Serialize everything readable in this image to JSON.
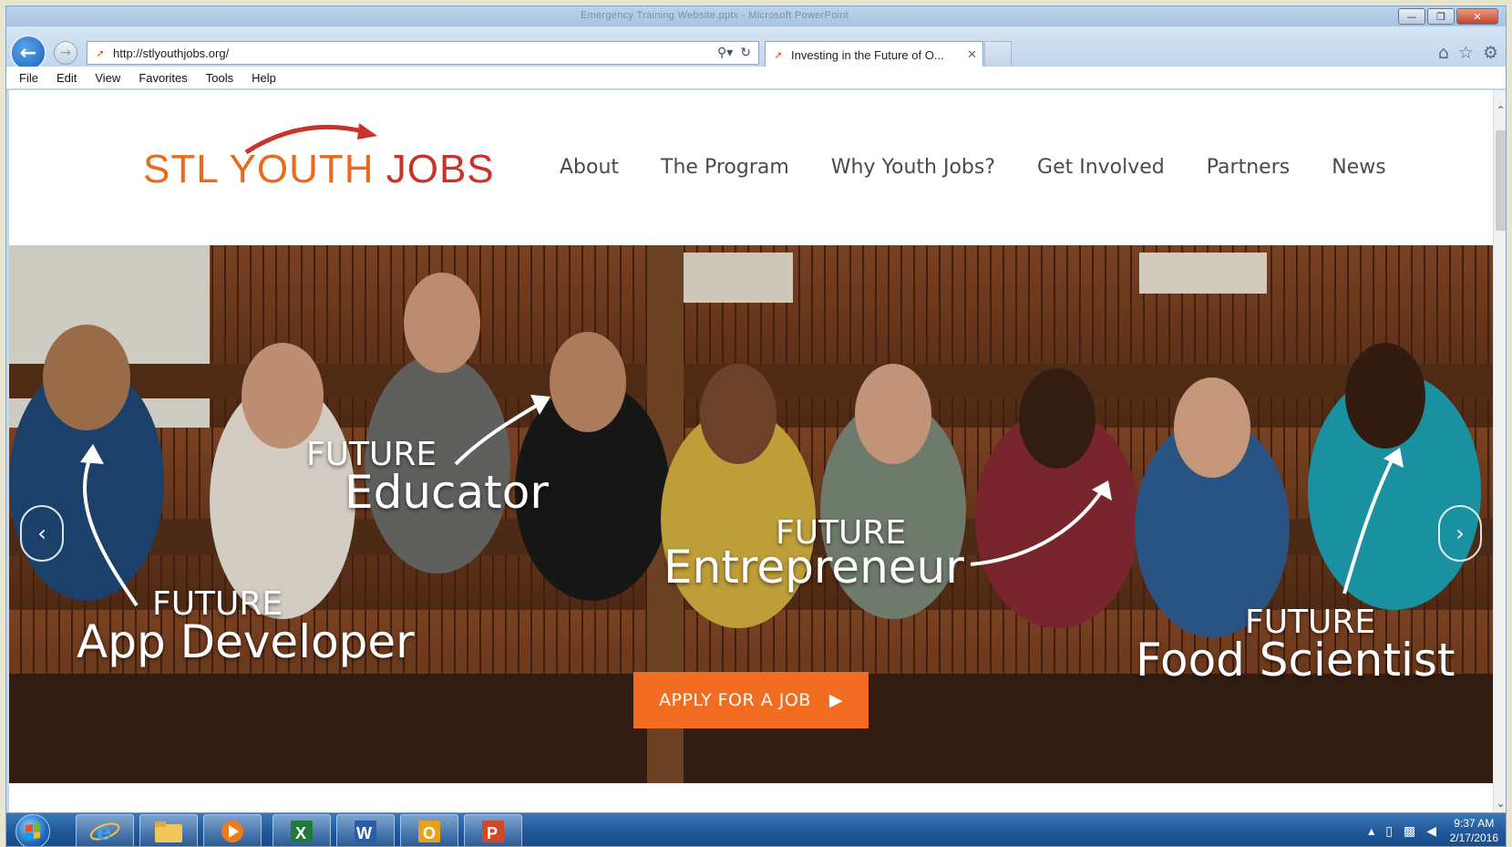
{
  "browser": {
    "window_title": "Emergency Training Website.pptx - Microsoft PowerPoint",
    "address": "http://stlyouthjobs.org/",
    "tab_title": "Investing in the Future of O...",
    "menu": [
      "File",
      "Edit",
      "View",
      "Favorites",
      "Tools",
      "Help"
    ]
  },
  "site": {
    "logo_stl": "STL",
    "logo_youth": "YOUTH",
    "logo_jobs": "JOBS",
    "nav": [
      "About",
      "The Program",
      "Why Youth Jobs?",
      "Get Involved",
      "Partners",
      "News"
    ]
  },
  "hero": {
    "captions": [
      {
        "small": "FUTURE",
        "big": "Educator"
      },
      {
        "small": "FUTURE",
        "big": "Entrepreneur"
      },
      {
        "small": "FUTURE",
        "big": "App Developer"
      },
      {
        "small": "FUTURE",
        "big": "Food Scientist"
      }
    ],
    "apply_label": "APPLY FOR A JOB"
  },
  "taskbar": {
    "time": "9:37 AM",
    "date": "2/17/2016"
  },
  "colors": {
    "brand_orange": "#e96a1f",
    "brand_red": "#c8332b",
    "button_orange": "#f26c21"
  }
}
